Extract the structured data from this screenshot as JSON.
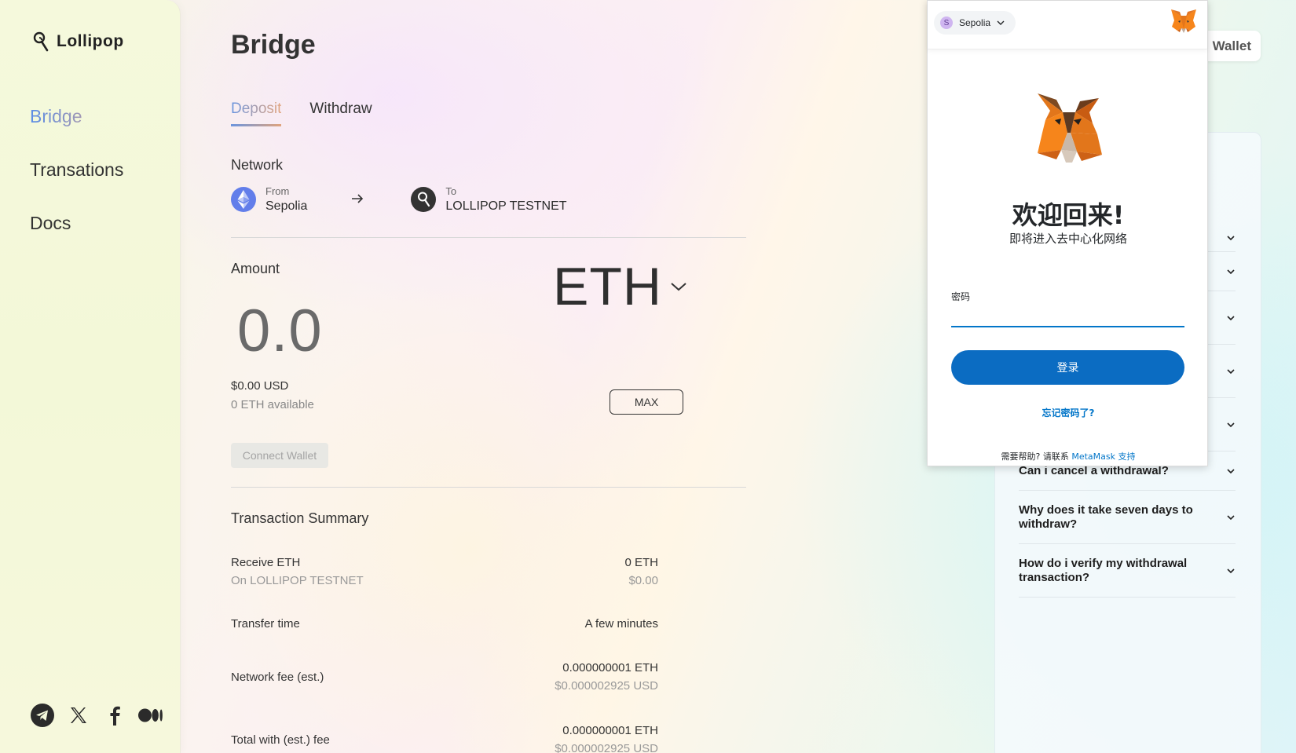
{
  "app": {
    "name": "Lollipop"
  },
  "sidebar": {
    "items": [
      {
        "label": "Bridge",
        "active": true
      },
      {
        "label": "Transations",
        "active": false
      },
      {
        "label": "Docs",
        "active": false
      }
    ],
    "socials": [
      "telegram-icon",
      "x-icon",
      "facebook-icon",
      "medium-icon"
    ]
  },
  "main": {
    "title": "Bridge",
    "tabs": [
      {
        "label": "Deposit",
        "active": true
      },
      {
        "label": "Withdraw",
        "active": false
      }
    ],
    "network": {
      "label": "Network",
      "from_label": "From",
      "from_name": "Sepolia",
      "to_label": "To",
      "to_name": "LOLLIPOP TESTNET"
    },
    "amount": {
      "label": "Amount",
      "value": "0.0",
      "token": "ETH",
      "usd": "$0.00 USD",
      "available": "0 ETH available",
      "max_label": "MAX"
    },
    "connect_label": "Connect Wallet",
    "summary": {
      "title": "Transaction Summary",
      "receive_label": "Receive ETH",
      "receive_sub": "On LOLLIPOP TESTNET",
      "receive_value": "0 ETH",
      "receive_usd": "$0.00",
      "transfer_label": "Transfer time",
      "transfer_value": "A few minutes",
      "fee_label": "Network fee (est.)",
      "fee_value": "0.000000001 ETH",
      "fee_usd": "$0.000002925 USD",
      "total_label": "Total with (est.) fee",
      "total_value": "0.000000001 ETH",
      "total_usd": "$0.000002925 USD"
    }
  },
  "header": {
    "wallet_label": "Wallet"
  },
  "faq": {
    "items": [
      {
        "question": ""
      },
      {
        "question": ""
      },
      {
        "question": ""
      },
      {
        "question": ""
      },
      {
        "question": ""
      },
      {
        "question": "Can i cancel a withdrawal?"
      },
      {
        "question": "Why does it take seven days to withdraw?"
      },
      {
        "question": "How do i verify my withdrawal transaction?"
      }
    ]
  },
  "metamask": {
    "network_badge": "S",
    "network_name": "Sepolia",
    "title": "欢迎回来!",
    "subtitle": "即将进入去中心化网络",
    "password_label": "密码",
    "password_value": "",
    "login_label": "登录",
    "forgot_label": "忘记密码了?",
    "help_text": "需要帮助? 请联系 ",
    "help_link": "MetaMask 支持"
  },
  "colors": {
    "accent_blue": "#6a95e0",
    "accent_orange": "#e2a47c",
    "metamask_blue": "#0b6cc2",
    "eth_blue": "#627eea"
  }
}
